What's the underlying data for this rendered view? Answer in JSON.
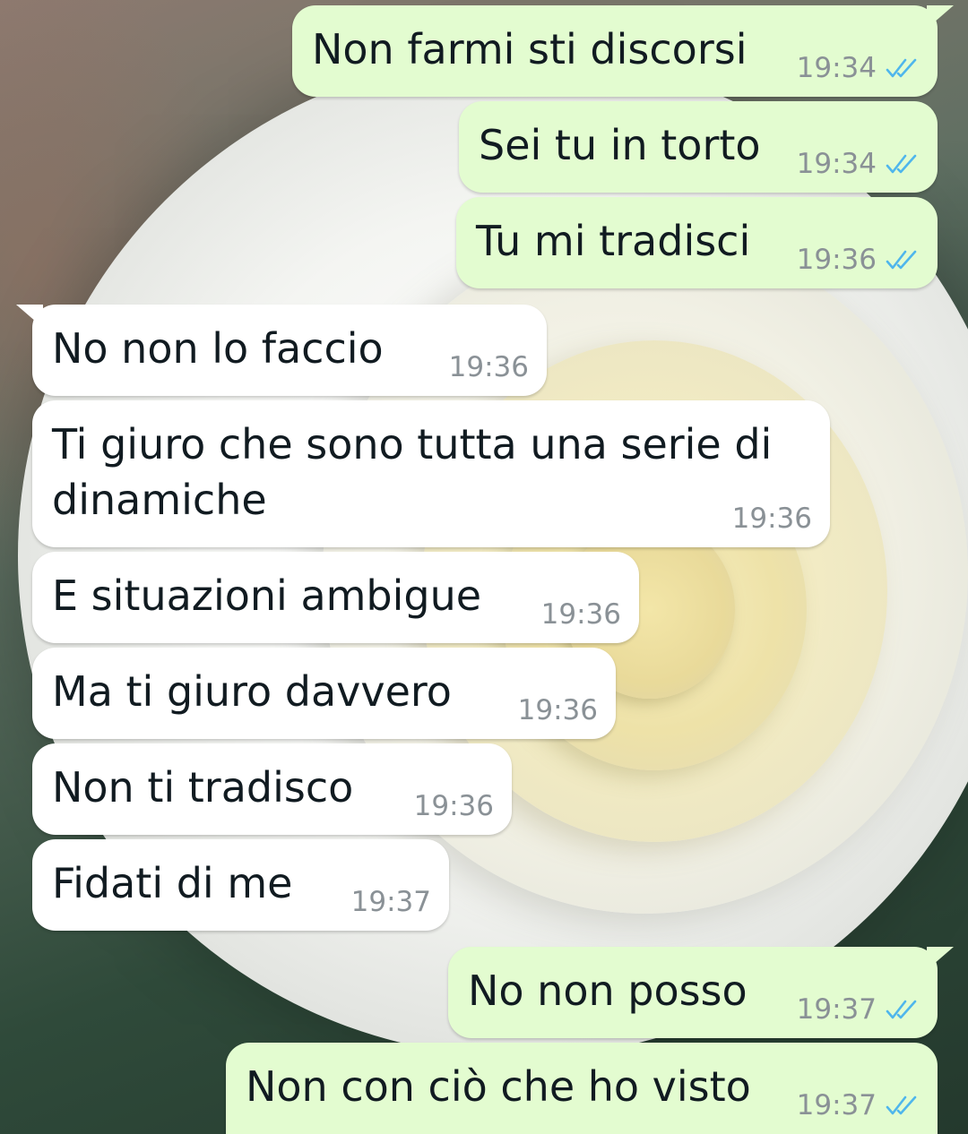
{
  "messages": [
    {
      "direction": "out",
      "text": "Non farmi sti discorsi",
      "time": "19:34",
      "status": "read"
    },
    {
      "direction": "out",
      "text": "Sei tu in torto",
      "time": "19:34",
      "status": "read"
    },
    {
      "direction": "out",
      "text": "Tu mi tradisci",
      "time": "19:36",
      "status": "read"
    },
    {
      "direction": "in",
      "text": "No non lo faccio",
      "time": "19:36"
    },
    {
      "direction": "in",
      "text": "Ti giuro che sono tutta una serie di dinamiche",
      "time": "19:36"
    },
    {
      "direction": "in",
      "text": "E situazioni ambigue",
      "time": "19:36"
    },
    {
      "direction": "in",
      "text": "Ma ti giuro davvero",
      "time": "19:36"
    },
    {
      "direction": "in",
      "text": "Non ti tradisco",
      "time": "19:36"
    },
    {
      "direction": "in",
      "text": "Fidati di me",
      "time": "19:37"
    },
    {
      "direction": "out",
      "text": "No non posso",
      "time": "19:37",
      "status": "read"
    },
    {
      "direction": "out",
      "text": "Non con ciò che ho visto",
      "time": "19:37",
      "status": "read"
    }
  ],
  "colors": {
    "outgoing_bubble": "#e3fcd0",
    "incoming_bubble": "#ffffff",
    "read_ticks": "#4fb6ec",
    "timestamp": "#8a9196"
  },
  "icons": {
    "read_receipt": "double-check-icon",
    "wallpaper": "white-rose"
  }
}
